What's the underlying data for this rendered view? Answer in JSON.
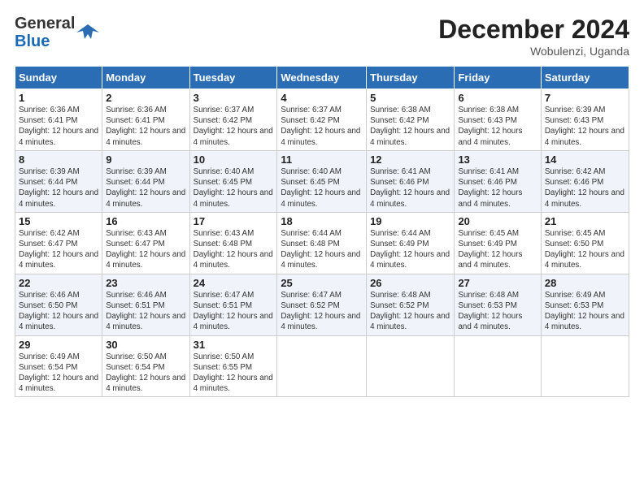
{
  "logo": {
    "general": "General",
    "blue": "Blue"
  },
  "title": "December 2024",
  "location": "Wobulenzi, Uganda",
  "headers": [
    "Sunday",
    "Monday",
    "Tuesday",
    "Wednesday",
    "Thursday",
    "Friday",
    "Saturday"
  ],
  "weeks": [
    [
      {
        "day": "1",
        "info": "Sunrise: 6:36 AM\nSunset: 6:41 PM\nDaylight: 12 hours and 4 minutes."
      },
      {
        "day": "2",
        "info": "Sunrise: 6:36 AM\nSunset: 6:41 PM\nDaylight: 12 hours and 4 minutes."
      },
      {
        "day": "3",
        "info": "Sunrise: 6:37 AM\nSunset: 6:42 PM\nDaylight: 12 hours and 4 minutes."
      },
      {
        "day": "4",
        "info": "Sunrise: 6:37 AM\nSunset: 6:42 PM\nDaylight: 12 hours and 4 minutes."
      },
      {
        "day": "5",
        "info": "Sunrise: 6:38 AM\nSunset: 6:42 PM\nDaylight: 12 hours and 4 minutes."
      },
      {
        "day": "6",
        "info": "Sunrise: 6:38 AM\nSunset: 6:43 PM\nDaylight: 12 hours and 4 minutes."
      },
      {
        "day": "7",
        "info": "Sunrise: 6:39 AM\nSunset: 6:43 PM\nDaylight: 12 hours and 4 minutes."
      }
    ],
    [
      {
        "day": "8",
        "info": "Sunrise: 6:39 AM\nSunset: 6:44 PM\nDaylight: 12 hours and 4 minutes."
      },
      {
        "day": "9",
        "info": "Sunrise: 6:39 AM\nSunset: 6:44 PM\nDaylight: 12 hours and 4 minutes."
      },
      {
        "day": "10",
        "info": "Sunrise: 6:40 AM\nSunset: 6:45 PM\nDaylight: 12 hours and 4 minutes."
      },
      {
        "day": "11",
        "info": "Sunrise: 6:40 AM\nSunset: 6:45 PM\nDaylight: 12 hours and 4 minutes."
      },
      {
        "day": "12",
        "info": "Sunrise: 6:41 AM\nSunset: 6:46 PM\nDaylight: 12 hours and 4 minutes."
      },
      {
        "day": "13",
        "info": "Sunrise: 6:41 AM\nSunset: 6:46 PM\nDaylight: 12 hours and 4 minutes."
      },
      {
        "day": "14",
        "info": "Sunrise: 6:42 AM\nSunset: 6:46 PM\nDaylight: 12 hours and 4 minutes."
      }
    ],
    [
      {
        "day": "15",
        "info": "Sunrise: 6:42 AM\nSunset: 6:47 PM\nDaylight: 12 hours and 4 minutes."
      },
      {
        "day": "16",
        "info": "Sunrise: 6:43 AM\nSunset: 6:47 PM\nDaylight: 12 hours and 4 minutes."
      },
      {
        "day": "17",
        "info": "Sunrise: 6:43 AM\nSunset: 6:48 PM\nDaylight: 12 hours and 4 minutes."
      },
      {
        "day": "18",
        "info": "Sunrise: 6:44 AM\nSunset: 6:48 PM\nDaylight: 12 hours and 4 minutes."
      },
      {
        "day": "19",
        "info": "Sunrise: 6:44 AM\nSunset: 6:49 PM\nDaylight: 12 hours and 4 minutes."
      },
      {
        "day": "20",
        "info": "Sunrise: 6:45 AM\nSunset: 6:49 PM\nDaylight: 12 hours and 4 minutes."
      },
      {
        "day": "21",
        "info": "Sunrise: 6:45 AM\nSunset: 6:50 PM\nDaylight: 12 hours and 4 minutes."
      }
    ],
    [
      {
        "day": "22",
        "info": "Sunrise: 6:46 AM\nSunset: 6:50 PM\nDaylight: 12 hours and 4 minutes."
      },
      {
        "day": "23",
        "info": "Sunrise: 6:46 AM\nSunset: 6:51 PM\nDaylight: 12 hours and 4 minutes."
      },
      {
        "day": "24",
        "info": "Sunrise: 6:47 AM\nSunset: 6:51 PM\nDaylight: 12 hours and 4 minutes."
      },
      {
        "day": "25",
        "info": "Sunrise: 6:47 AM\nSunset: 6:52 PM\nDaylight: 12 hours and 4 minutes."
      },
      {
        "day": "26",
        "info": "Sunrise: 6:48 AM\nSunset: 6:52 PM\nDaylight: 12 hours and 4 minutes."
      },
      {
        "day": "27",
        "info": "Sunrise: 6:48 AM\nSunset: 6:53 PM\nDaylight: 12 hours and 4 minutes."
      },
      {
        "day": "28",
        "info": "Sunrise: 6:49 AM\nSunset: 6:53 PM\nDaylight: 12 hours and 4 minutes."
      }
    ],
    [
      {
        "day": "29",
        "info": "Sunrise: 6:49 AM\nSunset: 6:54 PM\nDaylight: 12 hours and 4 minutes."
      },
      {
        "day": "30",
        "info": "Sunrise: 6:50 AM\nSunset: 6:54 PM\nDaylight: 12 hours and 4 minutes."
      },
      {
        "day": "31",
        "info": "Sunrise: 6:50 AM\nSunset: 6:55 PM\nDaylight: 12 hours and 4 minutes."
      },
      {
        "day": "",
        "info": ""
      },
      {
        "day": "",
        "info": ""
      },
      {
        "day": "",
        "info": ""
      },
      {
        "day": "",
        "info": ""
      }
    ]
  ]
}
